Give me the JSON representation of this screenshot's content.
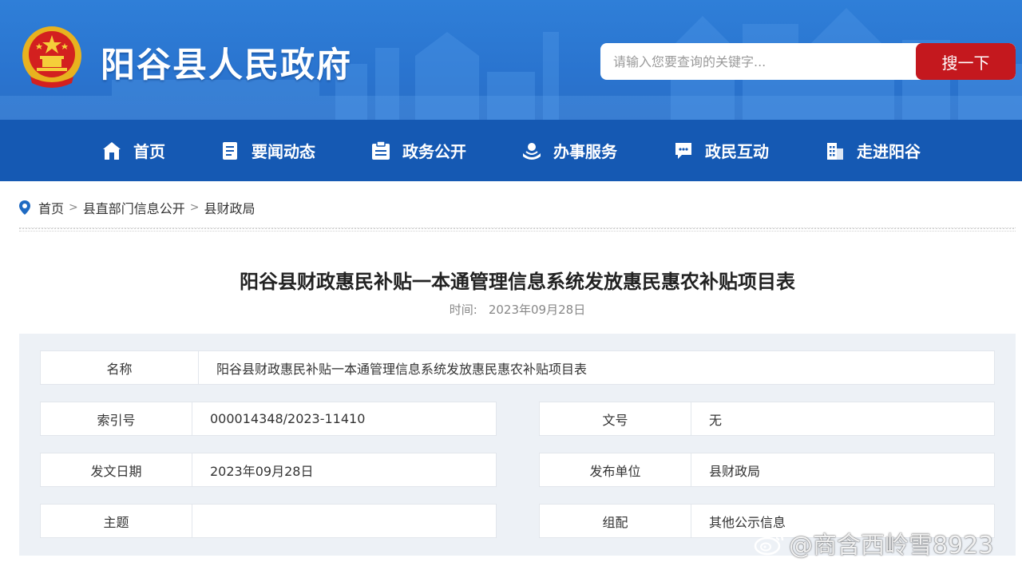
{
  "header": {
    "site_title": "阳谷县人民政府",
    "search_placeholder": "请输入您要查询的关键字...",
    "search_button": "搜一下",
    "colors": {
      "banner": "#2a74cf",
      "nav": "#1559b3",
      "search_button": "#c4181e"
    }
  },
  "nav": {
    "items": [
      {
        "label": "首页",
        "icon": "home-icon"
      },
      {
        "label": "要闻动态",
        "icon": "news-icon"
      },
      {
        "label": "政务公开",
        "icon": "public-affairs-icon"
      },
      {
        "label": "办事服务",
        "icon": "service-icon"
      },
      {
        "label": "政民互动",
        "icon": "chat-icon"
      },
      {
        "label": "走进阳谷",
        "icon": "building-icon"
      }
    ]
  },
  "breadcrumb": {
    "items": [
      "首页",
      "县直部门信息公开",
      "县财政局"
    ],
    "separator": ">"
  },
  "article": {
    "title": "阳谷县财政惠民补贴一本通管理信息系统发放惠民惠农补贴项目表",
    "time_label": "时间:",
    "time_value": "2023年09月28日"
  },
  "info": {
    "name_label": "名称",
    "name_value": "阳谷县财政惠民补贴一本通管理信息系统发放惠民惠农补贴项目表",
    "index_label": "索引号",
    "index_value": "000014348/2023-11410",
    "doc_no_label": "文号",
    "doc_no_value": "无",
    "date_label": "发文日期",
    "date_value": "2023年09月28日",
    "publisher_label": "发布单位",
    "publisher_value": "县财政局",
    "topic_label": "主题",
    "topic_value": "",
    "category_label": "组配",
    "category_value": "其他公示信息"
  },
  "watermark": {
    "text": "@商含西岭雪8923",
    "icon": "weibo-icon"
  }
}
